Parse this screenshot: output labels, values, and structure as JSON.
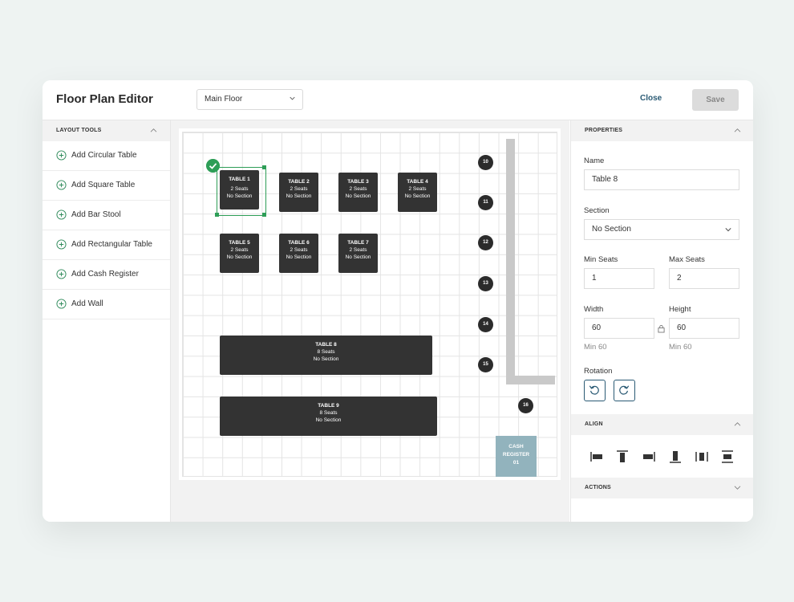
{
  "header": {
    "title": "Floor Plan Editor",
    "floor_select": "Main Floor",
    "close_label": "Close",
    "save_label": "Save"
  },
  "layout_tools": {
    "title": "LAYOUT TOOLS",
    "items": [
      {
        "label": "Add Circular Table"
      },
      {
        "label": "Add Square Table"
      },
      {
        "label": "Add Bar Stool"
      },
      {
        "label": "Add Rectangular Table"
      },
      {
        "label": "Add Cash Register"
      },
      {
        "label": "Add Wall"
      }
    ]
  },
  "canvas": {
    "tables": [
      {
        "name": "TABLE 1",
        "seats": "2 Seats",
        "section": "No Section"
      },
      {
        "name": "TABLE 2",
        "seats": "2 Seats",
        "section": "No Section"
      },
      {
        "name": "TABLE 3",
        "seats": "2 Seats",
        "section": "No Section"
      },
      {
        "name": "TABLE 4",
        "seats": "2 Seats",
        "section": "No Section"
      },
      {
        "name": "TABLE 5",
        "seats": "2 Seats",
        "section": "No Section"
      },
      {
        "name": "TABLE 6",
        "seats": "2 Seats",
        "section": "No Section"
      },
      {
        "name": "TABLE 7",
        "seats": "2 Seats",
        "section": "No Section"
      },
      {
        "name": "TABLE 8",
        "seats": "8 Seats",
        "section": "No Section"
      },
      {
        "name": "TABLE 9",
        "seats": "8 Seats",
        "section": "No Section"
      }
    ],
    "stools": [
      "10",
      "11",
      "12",
      "13",
      "14",
      "15",
      "16"
    ],
    "cash_register": {
      "line1": "CASH",
      "line2": "REGISTER",
      "line3": "01"
    }
  },
  "properties": {
    "title": "PROPERTIES",
    "name_label": "Name",
    "name_value": "Table 8",
    "section_label": "Section",
    "section_value": "No Section",
    "min_seats_label": "Min Seats",
    "min_seats_value": "1",
    "max_seats_label": "Max Seats",
    "max_seats_value": "2",
    "width_label": "Width",
    "width_value": "60",
    "width_hint": "Min 60",
    "height_label": "Height",
    "height_value": "60",
    "height_hint": "Min 60",
    "rotation_label": "Rotation"
  },
  "align": {
    "title": "ALIGN"
  },
  "actions": {
    "title": "ACTIONS"
  },
  "colors": {
    "accent": "#2a5a74",
    "selection": "#2e9e57",
    "table": "#333333",
    "cash_register": "#92b3bd"
  }
}
